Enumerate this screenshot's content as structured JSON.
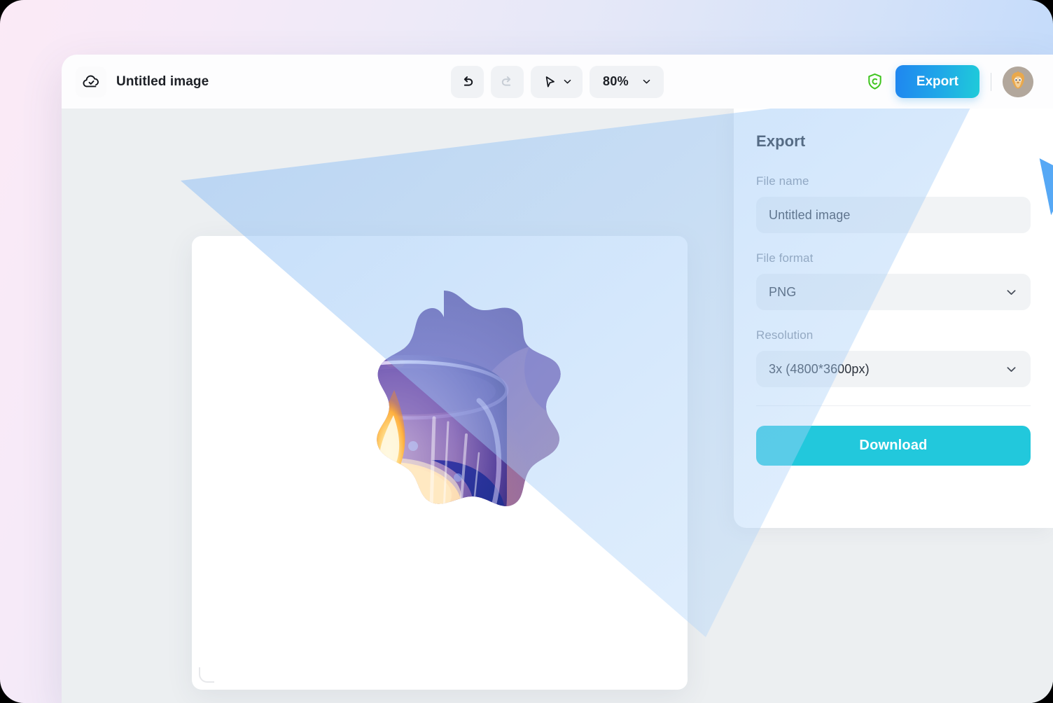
{
  "app": {
    "document_title": "Untitled image",
    "cloud_status_icon": "cloud-check-icon"
  },
  "toolbar": {
    "undo_icon": "undo-arrow-icon",
    "undo_label": "Undo",
    "redo_icon": "redo-arrow-icon",
    "redo_label": "Redo",
    "redo_disabled": true,
    "select_tool_icon": "cursor-arrow-icon",
    "select_tool_chevron": "chevron-down-icon",
    "zoom_level": "80%",
    "zoom_chevron": "chevron-down-icon"
  },
  "topbar_right": {
    "credits_icon": "shield-c-icon",
    "export_label": "Export",
    "avatar_icon": "user-avatar"
  },
  "panel": {
    "title": "Export",
    "file_name_label": "File name",
    "file_name_value": "Untitled image",
    "file_name_placeholder": "Untitled image",
    "file_format_label": "File format",
    "file_format_value": "PNG",
    "file_format_chevron": "chevron-down-icon",
    "resolution_label": "Resolution",
    "resolution_value": "3x (4800*3600px)",
    "resolution_multiplier": "3x",
    "resolution_dimensions": "(4800*3600px)",
    "resolution_chevron": "chevron-down-icon",
    "download_label": "Download"
  },
  "canvas": {
    "artboard_name": "artboard",
    "image_name": "candle-in-glass-image",
    "resize_handle_icon": "resize-corner-icon"
  },
  "pointer": {
    "icon": "blue-pointer-cursor"
  },
  "colors": {
    "export_gradient_start": "#1f86f0",
    "export_gradient_end": "#1fcbd9",
    "download_button": "#22c8dc",
    "credits_shield": "#3fc51f",
    "pointer_blue": "#56a8f5",
    "canvas_bg": "#eceff1",
    "field_bg": "#f1f3f5",
    "label_gray": "#868e9b"
  }
}
